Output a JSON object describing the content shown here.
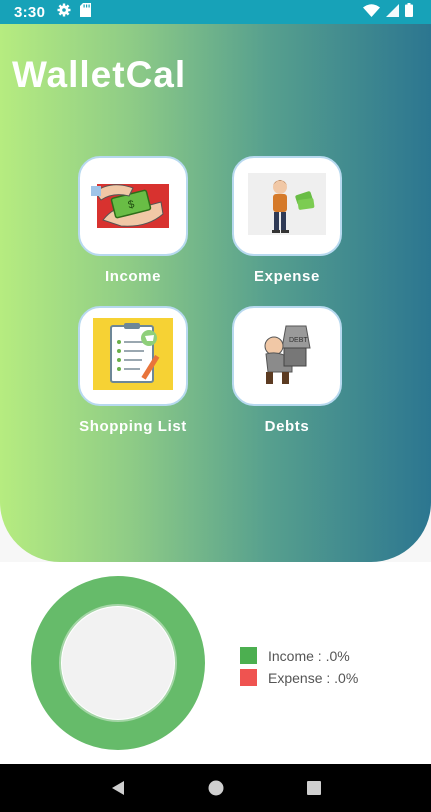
{
  "status_bar": {
    "time": "3:30",
    "icons": [
      "gear-icon",
      "sd-card-icon",
      "wifi-icon",
      "signal-icon",
      "battery-icon"
    ]
  },
  "app": {
    "title": "WalletCal"
  },
  "menu": {
    "items": [
      {
        "label": "Income",
        "icon": "income-money-hands-icon"
      },
      {
        "label": "Expense",
        "icon": "expense-man-with-cash-icon"
      },
      {
        "label": "Shopping List",
        "icon": "shopping-list-clipboard-icon"
      },
      {
        "label": "Debts",
        "icon": "debts-man-with-weight-icon"
      }
    ]
  },
  "summary": {
    "income_label": "Income : .0%",
    "expense_label": "Expense : .0%",
    "colors": {
      "income": "#4caf50",
      "expense": "#ef5350"
    }
  },
  "chart_data": {
    "type": "pie",
    "categories": [
      "Income",
      "Expense"
    ],
    "values": [
      0,
      0
    ],
    "colors": [
      "#4caf50",
      "#ef5350"
    ],
    "legend": "right"
  },
  "colors": {
    "status_bar": "#17a2b8",
    "gradient_start": "#b6ec80",
    "gradient_end": "#2c7690",
    "donut_ring": "#66bb6a"
  },
  "nav_bar": {
    "buttons": [
      "back-icon",
      "home-icon",
      "recents-icon"
    ]
  }
}
